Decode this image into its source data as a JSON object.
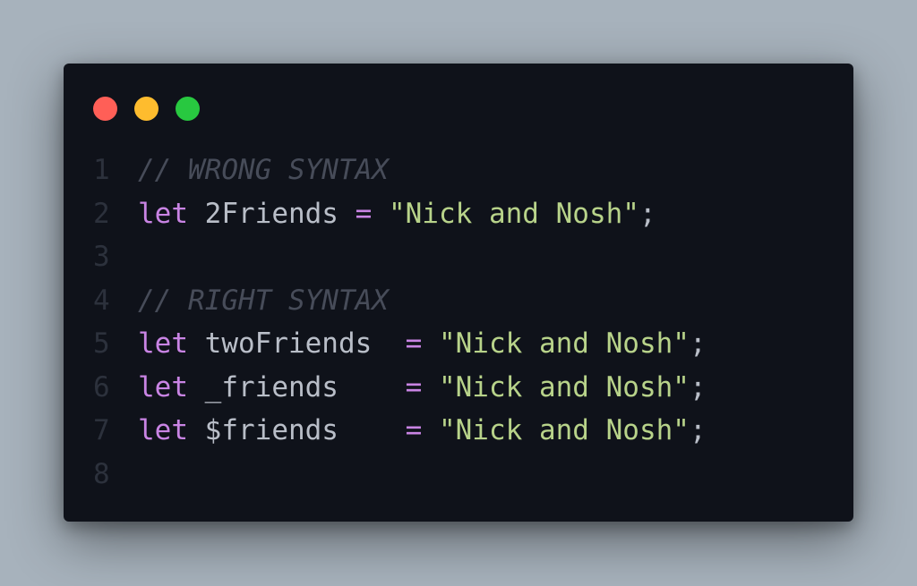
{
  "window": {
    "controls": {
      "close_color": "#ff5f57",
      "minimize_color": "#febc2e",
      "maximize_color": "#28c840"
    }
  },
  "code": {
    "lines": [
      {
        "number": "1",
        "tokens": [
          {
            "type": "comment",
            "text": "// WRONG SYNTAX"
          }
        ]
      },
      {
        "number": "2",
        "tokens": [
          {
            "type": "keyword",
            "text": "let"
          },
          {
            "type": "ident",
            "text": " 2Friends "
          },
          {
            "type": "op",
            "text": "="
          },
          {
            "type": "ident",
            "text": " "
          },
          {
            "type": "string",
            "text": "\"Nick and Nosh\""
          },
          {
            "type": "punct",
            "text": ";"
          }
        ]
      },
      {
        "number": "3",
        "tokens": []
      },
      {
        "number": "4",
        "tokens": [
          {
            "type": "comment",
            "text": "// RIGHT SYNTAX"
          }
        ]
      },
      {
        "number": "5",
        "tokens": [
          {
            "type": "keyword",
            "text": "let"
          },
          {
            "type": "ident",
            "text": " twoFriends  "
          },
          {
            "type": "op",
            "text": "="
          },
          {
            "type": "ident",
            "text": " "
          },
          {
            "type": "string",
            "text": "\"Nick and Nosh\""
          },
          {
            "type": "punct",
            "text": ";"
          }
        ]
      },
      {
        "number": "6",
        "tokens": [
          {
            "type": "keyword",
            "text": "let"
          },
          {
            "type": "ident",
            "text": " _friends    "
          },
          {
            "type": "op",
            "text": "="
          },
          {
            "type": "ident",
            "text": " "
          },
          {
            "type": "string",
            "text": "\"Nick and Nosh\""
          },
          {
            "type": "punct",
            "text": ";"
          }
        ]
      },
      {
        "number": "7",
        "tokens": [
          {
            "type": "keyword",
            "text": "let"
          },
          {
            "type": "ident",
            "text": " $friends    "
          },
          {
            "type": "op",
            "text": "="
          },
          {
            "type": "ident",
            "text": " "
          },
          {
            "type": "string",
            "text": "\"Nick and Nosh\""
          },
          {
            "type": "punct",
            "text": ";"
          }
        ]
      },
      {
        "number": "8",
        "tokens": []
      }
    ]
  }
}
